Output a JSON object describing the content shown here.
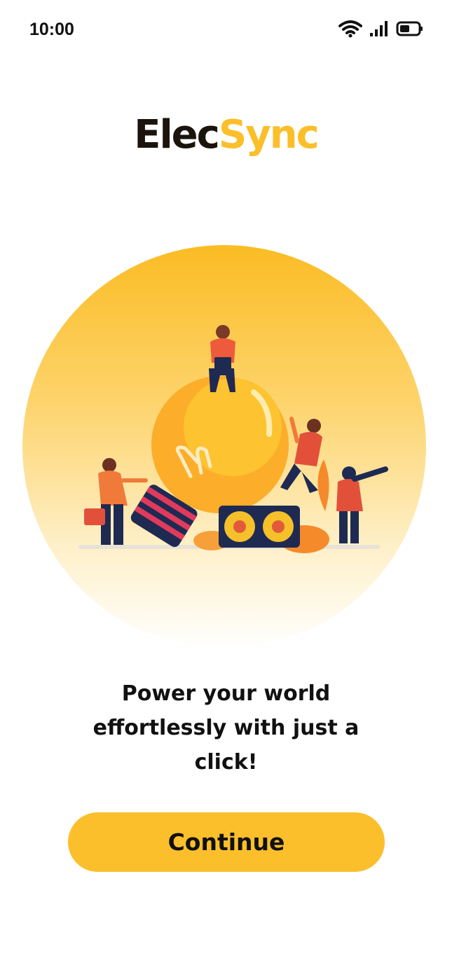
{
  "status_bar": {
    "time": "10:00",
    "icons": [
      "wifi-icon",
      "cellular-signal-icon",
      "battery-icon"
    ]
  },
  "brand": {
    "part1": "Elec",
    "part2": "Sync",
    "colors": {
      "dark": "#1a140c",
      "accent": "#fbbf2a"
    }
  },
  "hero": {
    "illustration": "lightbulb-people-illustration"
  },
  "tagline": "Power your world effortlessly with just a click!",
  "continue_button": {
    "label": "Continue",
    "color": "#fbbf2c"
  }
}
